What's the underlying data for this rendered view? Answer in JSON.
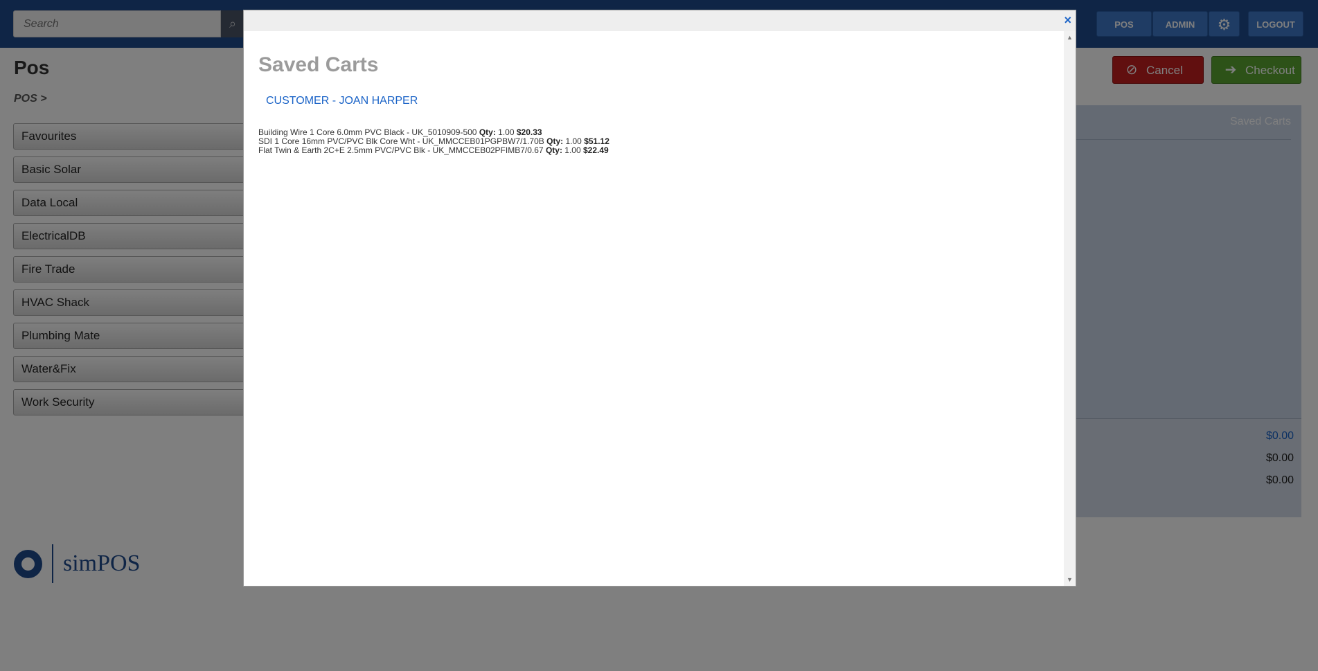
{
  "header": {
    "search_placeholder": "Search",
    "nav": {
      "pos": "POS",
      "admin": "ADMIN",
      "logout": "LOGOUT"
    }
  },
  "page": {
    "title": "Pos",
    "breadcrumb": "POS  >"
  },
  "categories": [
    "Favourites",
    "Basic Solar",
    "Data Local",
    "ElectricalDB",
    "Fire Trade",
    "HVAC Shack",
    "Plumbing Mate",
    "Water&Fix",
    "Work Security"
  ],
  "logo": {
    "text": "simPOS"
  },
  "actions": {
    "cancel": "Cancel",
    "checkout": "Checkout"
  },
  "cart": {
    "saved_carts_link": "Saved Carts",
    "totals": [
      "$0.00",
      "$0.00",
      "$0.00"
    ]
  },
  "modal": {
    "close": "×",
    "title": "Saved Carts",
    "customer": "CUSTOMER - JOAN HARPER",
    "qty_label": "Qty:",
    "items": [
      {
        "name": "Building Wire 1 Core 6.0mm PVC Black - UK_5010909-500",
        "qty": "1.00",
        "price": "$20.33"
      },
      {
        "name": "SDI 1 Core 16mm PVC/PVC Blk Core Wht - UK_MMCCEB01PGPBW7/1.70B",
        "qty": "1.00",
        "price": "$51.12"
      },
      {
        "name": "Flat Twin & Earth 2C+E 2.5mm PVC/PVC Blk - UK_MMCCEB02PFIMB7/0.67",
        "qty": "1.00",
        "price": "$22.49"
      }
    ]
  },
  "colors": {
    "header_bg": "#1f4a8c",
    "link_blue": "#1a63c7",
    "cancel_red": "#c31e1e",
    "checkout_green": "#5aa531"
  }
}
